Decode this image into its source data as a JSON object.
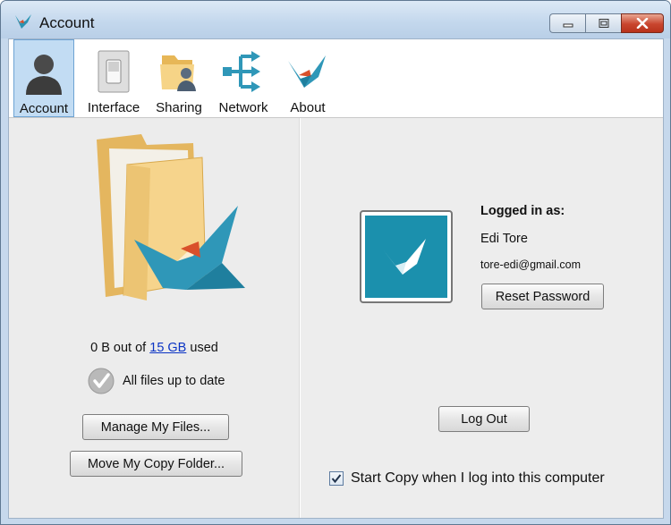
{
  "window": {
    "title": "Account"
  },
  "toolbar": {
    "items": [
      {
        "label": "Account",
        "icon": "account-icon"
      },
      {
        "label": "Interface",
        "icon": "interface-icon"
      },
      {
        "label": "Sharing",
        "icon": "sharing-icon"
      },
      {
        "label": "Network",
        "icon": "network-icon"
      },
      {
        "label": "About",
        "icon": "about-icon"
      }
    ],
    "active": "Account"
  },
  "storage": {
    "usage_prefix": "0 B out of",
    "quota_link": "15 GB",
    "usage_suffix": "used",
    "status": "All files up to date"
  },
  "buttons": {
    "manage_files": "Manage My Files...",
    "move_folder": "Move My Copy Folder...",
    "reset_password": "Reset Password",
    "log_out": "Log Out"
  },
  "account": {
    "logged_in_label": "Logged in as:",
    "name": "Edi Tore",
    "email": "tore-edi@gmail.com"
  },
  "startup": {
    "label": "Start Copy when I log into this computer",
    "checked": true
  },
  "colors": {
    "brand_teal": "#1b90ad",
    "active_tab": "#c2dcf3",
    "link": "#0a33c4"
  }
}
